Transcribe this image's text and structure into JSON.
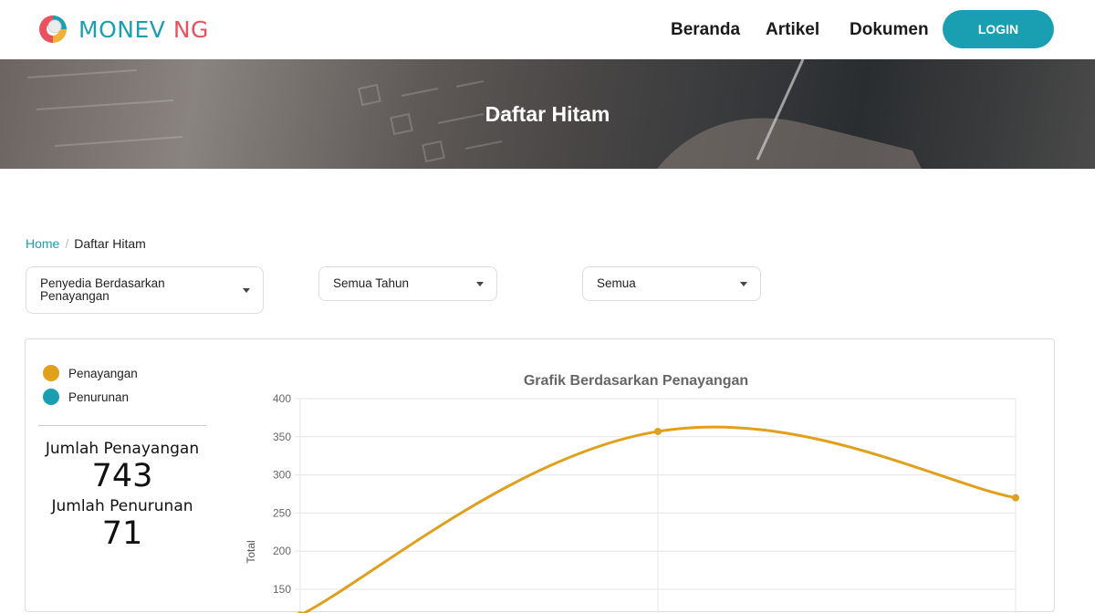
{
  "brand": {
    "name_part1": "MONEV",
    "name_part2": "NG",
    "logo_icon": "monev-logo-icon"
  },
  "nav": {
    "beranda": "Beranda",
    "artikel": "Artikel",
    "dokumen": "Dokumen",
    "login": "LOGIN"
  },
  "hero": {
    "title": "Daftar Hitam"
  },
  "breadcrumb": {
    "home": "Home",
    "separator": "/",
    "current": "Daftar Hitam"
  },
  "filters": {
    "type": "Penyedia Berdasarkan Penayangan",
    "year": "Semua Tahun",
    "scope": "Semua"
  },
  "legend": [
    {
      "label": "Penayangan",
      "color": "#e1a01c"
    },
    {
      "label": "Penurunan",
      "color": "#199fb1"
    }
  ],
  "stats": {
    "penayangan_label": "Jumlah Penayangan",
    "penayangan_value": "743",
    "penurunan_label": "Jumlah Penurunan",
    "penurunan_value": "71"
  },
  "colors": {
    "accent": "#199fb1",
    "brand_red": "#e9525d",
    "series": "#e1a01c"
  },
  "chart_data": {
    "type": "line",
    "title": "Grafik Berdasarkan Penayangan",
    "ylabel": "Total",
    "xlabel": "",
    "yticks": [
      "400",
      "350",
      "300",
      "250",
      "200",
      "150"
    ],
    "ylim": [
      150,
      400
    ],
    "grid": true,
    "smooth": true,
    "series": [
      {
        "name": "Penayangan",
        "values": [
          116,
          357,
          270
        ]
      }
    ]
  }
}
